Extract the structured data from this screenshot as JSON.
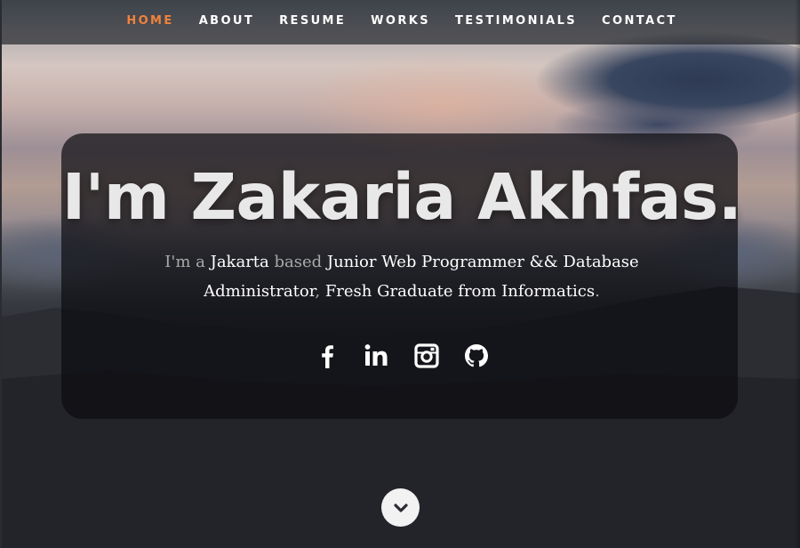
{
  "nav": {
    "items": [
      {
        "label": "HOME",
        "active": true
      },
      {
        "label": "ABOUT"
      },
      {
        "label": "RESUME"
      },
      {
        "label": "WORKS"
      },
      {
        "label": "TESTIMONIALS"
      },
      {
        "label": "CONTACT"
      }
    ],
    "active_color": "#f0823c"
  },
  "banner": {
    "title": "I'm Zakaria Akhfas.",
    "text": {
      "im_a": "I'm a ",
      "location": "Jakarta",
      "based": " based ",
      "role": "Junior Web Programmer && Database Administrator",
      "comma": ", ",
      "education": "Fresh Graduate from Informatics",
      "period": "."
    }
  },
  "social": [
    {
      "icon": "facebook-icon"
    },
    {
      "icon": "linkedin-icon"
    },
    {
      "icon": "instagram-icon"
    },
    {
      "icon": "github-icon"
    }
  ],
  "scroll_down": {
    "icon": "chevron-down-icon"
  }
}
